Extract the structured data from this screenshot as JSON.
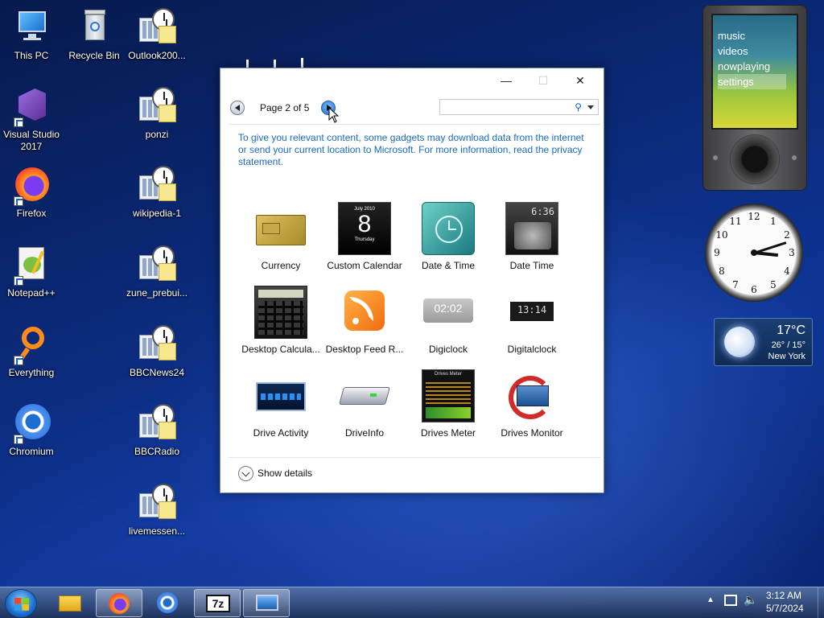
{
  "desktop": {
    "icons": [
      {
        "label": "This PC"
      },
      {
        "label": "Recycle Bin"
      },
      {
        "label": "Outlook200..."
      },
      {
        "label": "Visual Studio 2017"
      },
      {
        "label": "ponzi"
      },
      {
        "label": "Firefox"
      },
      {
        "label": "wikipedia-1"
      },
      {
        "label": "Notepad++"
      },
      {
        "label": "zune_prebui..."
      },
      {
        "label": "Everything"
      },
      {
        "label": "BBCNews24"
      },
      {
        "label": "Chromium"
      },
      {
        "label": "BBCRadio"
      },
      {
        "label": "livemessen..."
      }
    ]
  },
  "window": {
    "minimize": "—",
    "maximize": "☐",
    "close": "✕",
    "page_info": "Page 2 of 5",
    "search_placeholder": "",
    "privacy_text": "To give you relevant content, some gadgets may download data from the internet or send your current location to Microsoft. For more information, read the privacy statement.",
    "gadgets": [
      {
        "label": "Currency"
      },
      {
        "label": "Custom Calendar",
        "cal_month": "July 2010",
        "cal_day": "8",
        "cal_weekday": "Thursday"
      },
      {
        "label": "Date & Time"
      },
      {
        "label": "Date Time",
        "clock_text": "6:36"
      },
      {
        "label": "Desktop Calcula..."
      },
      {
        "label": "Desktop Feed R..."
      },
      {
        "label": "Digiclock",
        "clock_text": "02:02"
      },
      {
        "label": "Digitalclock",
        "clock_text": "13:14"
      },
      {
        "label": "Drive Activity"
      },
      {
        "label": "DriveInfo"
      },
      {
        "label": "Drives Meter",
        "title": "Drives Meter"
      },
      {
        "label": "Drives Monitor"
      }
    ],
    "show_details": "Show details"
  },
  "zune": {
    "menu": [
      "music",
      "videos",
      "nowplaying",
      "settings"
    ],
    "selected": "settings"
  },
  "clock": {
    "numbers": [
      "12",
      "1",
      "2",
      "3",
      "4",
      "5",
      "6",
      "7",
      "8",
      "9",
      "10",
      "11"
    ],
    "hour": 3,
    "minute": 12
  },
  "weather": {
    "temp": "17°C",
    "highlow": "26° / 15°",
    "city": "New York"
  },
  "taskbar": {
    "time": "3:12 AM",
    "date": "5/7/2024",
    "pinned": [
      "file-explorer",
      "firefox",
      "chromium",
      "7zip",
      "gadgets"
    ],
    "sevenzip_label": "7z"
  }
}
